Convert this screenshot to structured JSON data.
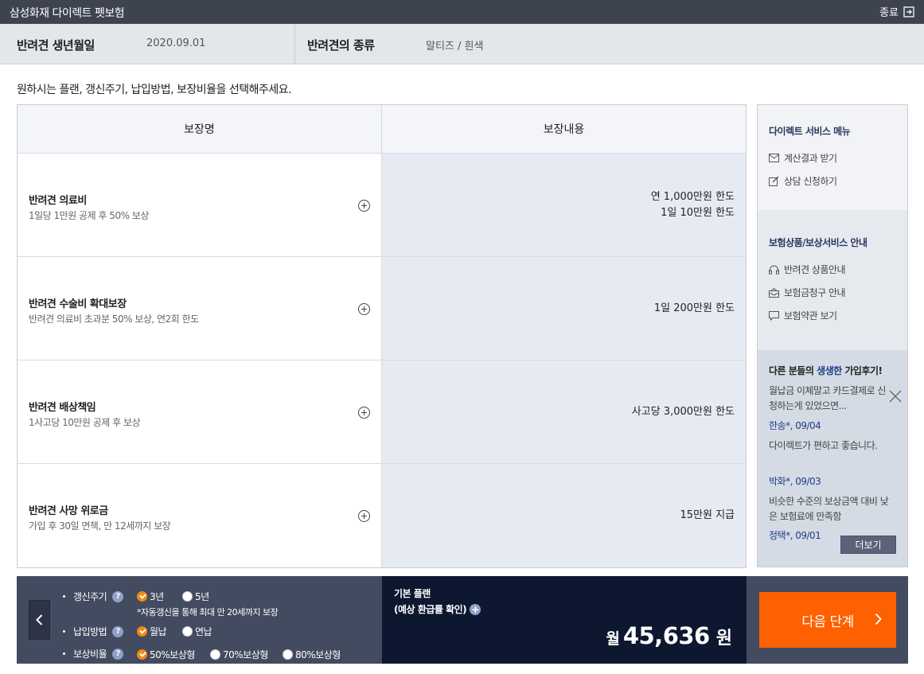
{
  "app": {
    "title": "삼성화재 다이렉트 펫보험",
    "close_label": "종료"
  },
  "pet": {
    "birth_label": "반려견 생년월일",
    "birth_value": "2020.09.01",
    "breed_label": "반려견의 종류",
    "breed_value": "말티즈 / 흰색"
  },
  "instruction": "원하시는 플랜, 갱신주기, 납입방법, 보장비율을 선택해주세요.",
  "coverage": {
    "header_name": "보장명",
    "header_detail": "보장내용",
    "rows": [
      {
        "name": "반려견 의료비",
        "desc": "1일당 1만원 공제 후 50% 보상",
        "line1": "연 1,000만원 한도",
        "line2": "1일 10만원 한도"
      },
      {
        "name": "반려견 수술비 확대보장",
        "desc": "반려견 의료비 초과분 50% 보상, 연2회 한도",
        "line1": "1일 200만원 한도",
        "line2": ""
      },
      {
        "name": "반려견 배상책임",
        "desc": "1사고당 10만원 공제 후 보상",
        "line1": "사고당 3,000만원 한도",
        "line2": ""
      },
      {
        "name": "반려견 사망 위로금",
        "desc": "가입 후 30일 면책, 만 12세까지 보장",
        "line1": "15만원 지급",
        "line2": ""
      }
    ]
  },
  "sidebar": {
    "service_title": "다이렉트 서비스 메뉴",
    "service_items": [
      "계산결과 받기",
      "상담 신청하기"
    ],
    "info_title": "보험상품/보상서비스 안내",
    "info_items": [
      "반려견 상품안내",
      "보험금청구 안내",
      "보험약관 보기"
    ],
    "review_title_prefix": "다른 분들의 ",
    "review_title_emph": "생생한",
    "review_title_suffix": " 가입후기!",
    "reviews": [
      {
        "text": "월납금 이체말고 카드결제로 신청하는게 있었으면...",
        "who": "한송*, 09/04"
      },
      {
        "text": "다이렉트가 편하고 좋습니다.",
        "who": "박화*, 09/03"
      },
      {
        "text": "비슷한 수준의 보상금액 대비 낮은 보험료에 만족함",
        "who": "정택*, 09/01"
      }
    ],
    "more_label": "더보기"
  },
  "options": {
    "renewal_label": "갱신주기",
    "renewal_opts": [
      "3년",
      "5년"
    ],
    "renewal_note": "*자동갱신을 통해 최대 만 20세까지 보장",
    "payment_label": "납입방법",
    "payment_opts": [
      "월납",
      "연납"
    ],
    "ratio_label": "보상비율",
    "ratio_opts": [
      "50%보상형",
      "70%보상형",
      "80%보상형"
    ],
    "help_glyph": "?"
  },
  "plan": {
    "title": "기본 플랜",
    "subtitle": "(예상 환급률 확인)",
    "plus_glyph": "+",
    "price_prefix": "월",
    "price_amount": "45,636",
    "price_suffix": "원"
  },
  "next_label": "다음 단계",
  "colors": {
    "topbar": "#3e4350",
    "accent": "#ff6000",
    "check": "#f08a12",
    "plan_bg": "#0d1830"
  }
}
